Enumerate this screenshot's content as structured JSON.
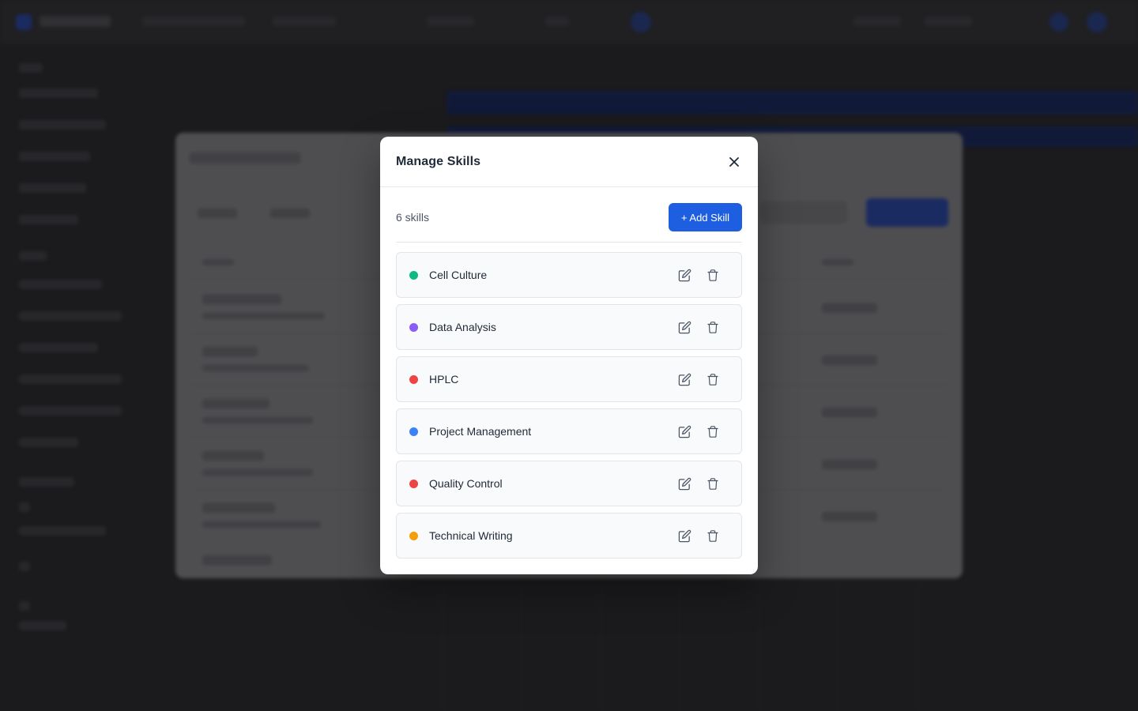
{
  "modal": {
    "title": "Manage Skills",
    "skill_count": "6 skills",
    "add_label": "+ Add Skill",
    "close_icon": "close-icon",
    "skills": [
      {
        "name": "Cell Culture",
        "color": "#10b981"
      },
      {
        "name": "Data Analysis",
        "color": "#8b5cf6"
      },
      {
        "name": "HPLC",
        "color": "#ef4444"
      },
      {
        "name": "Project Management",
        "color": "#3b82f6"
      },
      {
        "name": "Quality Control",
        "color": "#ef4444"
      },
      {
        "name": "Technical Writing",
        "color": "#f59e0b"
      }
    ],
    "row_icons": [
      "edit-icon",
      "trash-icon"
    ]
  },
  "colors": {
    "accent": "#1d5fe0",
    "page_backdrop": "#1f1f21",
    "background_dialog": "#8a8a8e"
  }
}
